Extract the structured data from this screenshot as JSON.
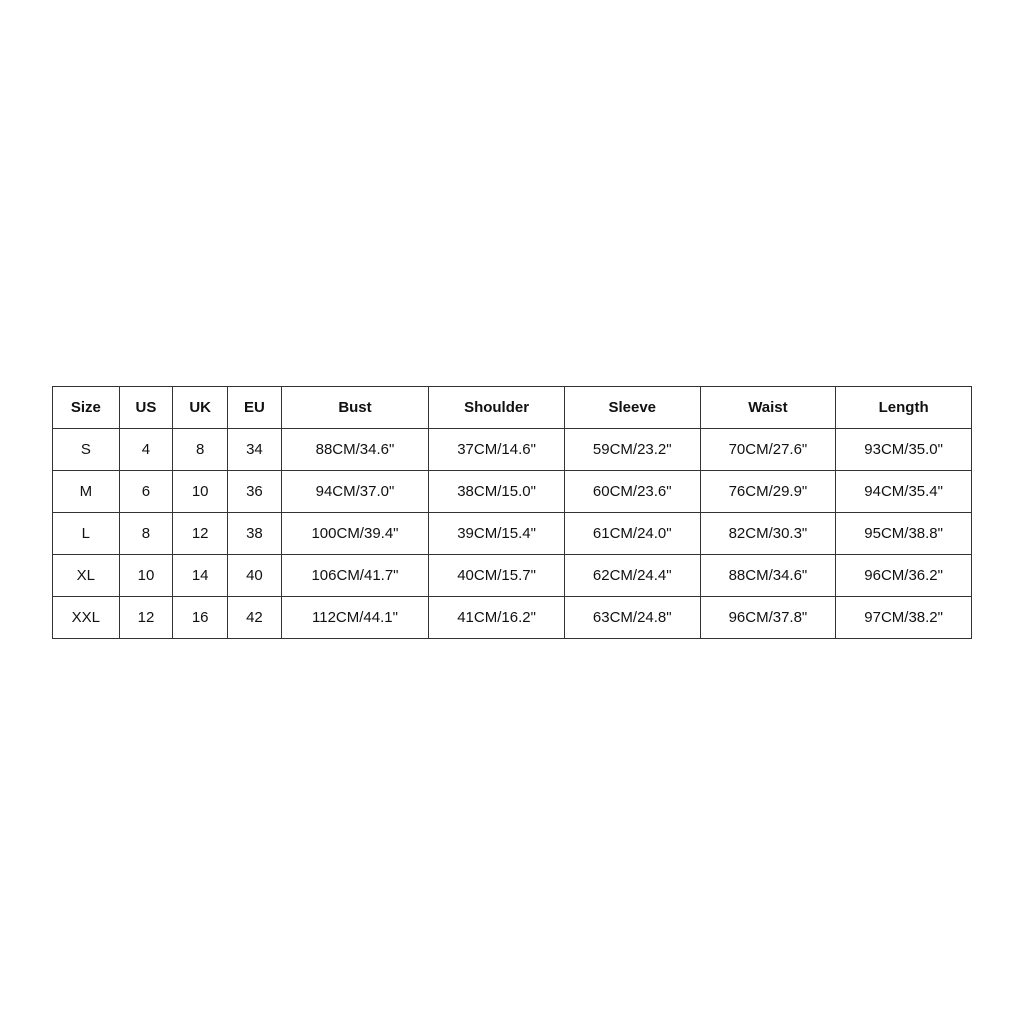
{
  "table": {
    "headers": [
      "Size",
      "US",
      "UK",
      "EU",
      "Bust",
      "Shoulder",
      "Sleeve",
      "Waist",
      "Length"
    ],
    "rows": [
      {
        "size": "S",
        "us": "4",
        "uk": "8",
        "eu": "34",
        "bust": "88CM/34.6\"",
        "shoulder": "37CM/14.6\"",
        "sleeve": "59CM/23.2\"",
        "waist": "70CM/27.6\"",
        "length": "93CM/35.0\""
      },
      {
        "size": "M",
        "us": "6",
        "uk": "10",
        "eu": "36",
        "bust": "94CM/37.0\"",
        "shoulder": "38CM/15.0\"",
        "sleeve": "60CM/23.6\"",
        "waist": "76CM/29.9\"",
        "length": "94CM/35.4\""
      },
      {
        "size": "L",
        "us": "8",
        "uk": "12",
        "eu": "38",
        "bust": "100CM/39.4\"",
        "shoulder": "39CM/15.4\"",
        "sleeve": "61CM/24.0\"",
        "waist": "82CM/30.3\"",
        "length": "95CM/38.8\""
      },
      {
        "size": "XL",
        "us": "10",
        "uk": "14",
        "eu": "40",
        "bust": "106CM/41.7\"",
        "shoulder": "40CM/15.7\"",
        "sleeve": "62CM/24.4\"",
        "waist": "88CM/34.6\"",
        "length": "96CM/36.2\""
      },
      {
        "size": "XXL",
        "us": "12",
        "uk": "16",
        "eu": "42",
        "bust": "112CM/44.1\"",
        "shoulder": "41CM/16.2\"",
        "sleeve": "63CM/24.8\"",
        "waist": "96CM/37.8\"",
        "length": "97CM/38.2\""
      }
    ]
  }
}
